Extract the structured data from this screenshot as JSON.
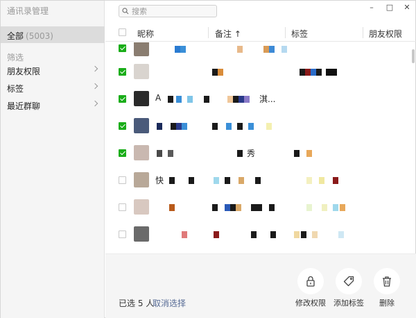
{
  "window": {
    "title": "通讯录管理",
    "controls": {
      "minimize": "–",
      "maximize": "□",
      "close": "✕"
    }
  },
  "sidebar": {
    "all": {
      "label": "全部",
      "count": "(5003)"
    },
    "filter_heading": "筛选",
    "items": [
      {
        "label": "朋友权限"
      },
      {
        "label": "标签"
      },
      {
        "label": "最近群聊"
      }
    ]
  },
  "search": {
    "placeholder": "搜索",
    "value": ""
  },
  "table": {
    "columns": [
      "昵称",
      "备注 ↑",
      "标签",
      "朋友权限"
    ],
    "rows": [
      {
        "checked": true,
        "name": ""
      },
      {
        "checked": true,
        "name": ""
      },
      {
        "checked": true,
        "name": "A",
        "remark": "淇..."
      },
      {
        "checked": true,
        "name": ""
      },
      {
        "checked": true,
        "name": "",
        "remark": "秀"
      },
      {
        "checked": false,
        "name": "快"
      },
      {
        "checked": false,
        "name": ""
      },
      {
        "checked": false,
        "name": ""
      }
    ]
  },
  "footer": {
    "selected_text": "已选 5 人",
    "deselect_label": "取消选择",
    "actions": [
      {
        "label": "修改权限",
        "icon": "lock-icon"
      },
      {
        "label": "添加标签",
        "icon": "tag-icon"
      },
      {
        "label": "删除",
        "icon": "trash-icon"
      }
    ]
  },
  "colors": {
    "accent_green": "#1aad19",
    "link_blue": "#576b95"
  }
}
